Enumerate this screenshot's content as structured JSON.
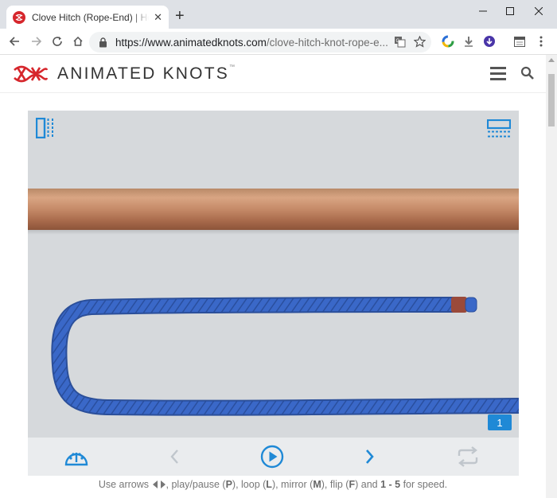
{
  "browser": {
    "tab_title": "Clove Hitch (Rope-End) | How t",
    "new_tab": "+",
    "url_main": "https://www.animatedknots.com",
    "url_rest": "/clove-hitch-knot-rope-e..."
  },
  "site": {
    "logo_text": "ANIMATED KNOTS",
    "trademark": "™"
  },
  "player": {
    "frame_number": "1"
  },
  "hint": {
    "use_arrows": "Use arrows",
    "play_pause_text": ", play/pause (",
    "play_key": "P",
    "loop_text": "), loop (",
    "loop_key": "L",
    "mirror_text": "), mirror (",
    "mirror_key": "M",
    "flip_text": "), flip (",
    "flip_key": "F",
    "and_text": ") and ",
    "speed_range": "1 - 5",
    "speed_text": " for speed."
  },
  "colors": {
    "accent": "#1f89d6",
    "brand_red": "#d6262c",
    "rope_blue": "#3a68c8"
  }
}
